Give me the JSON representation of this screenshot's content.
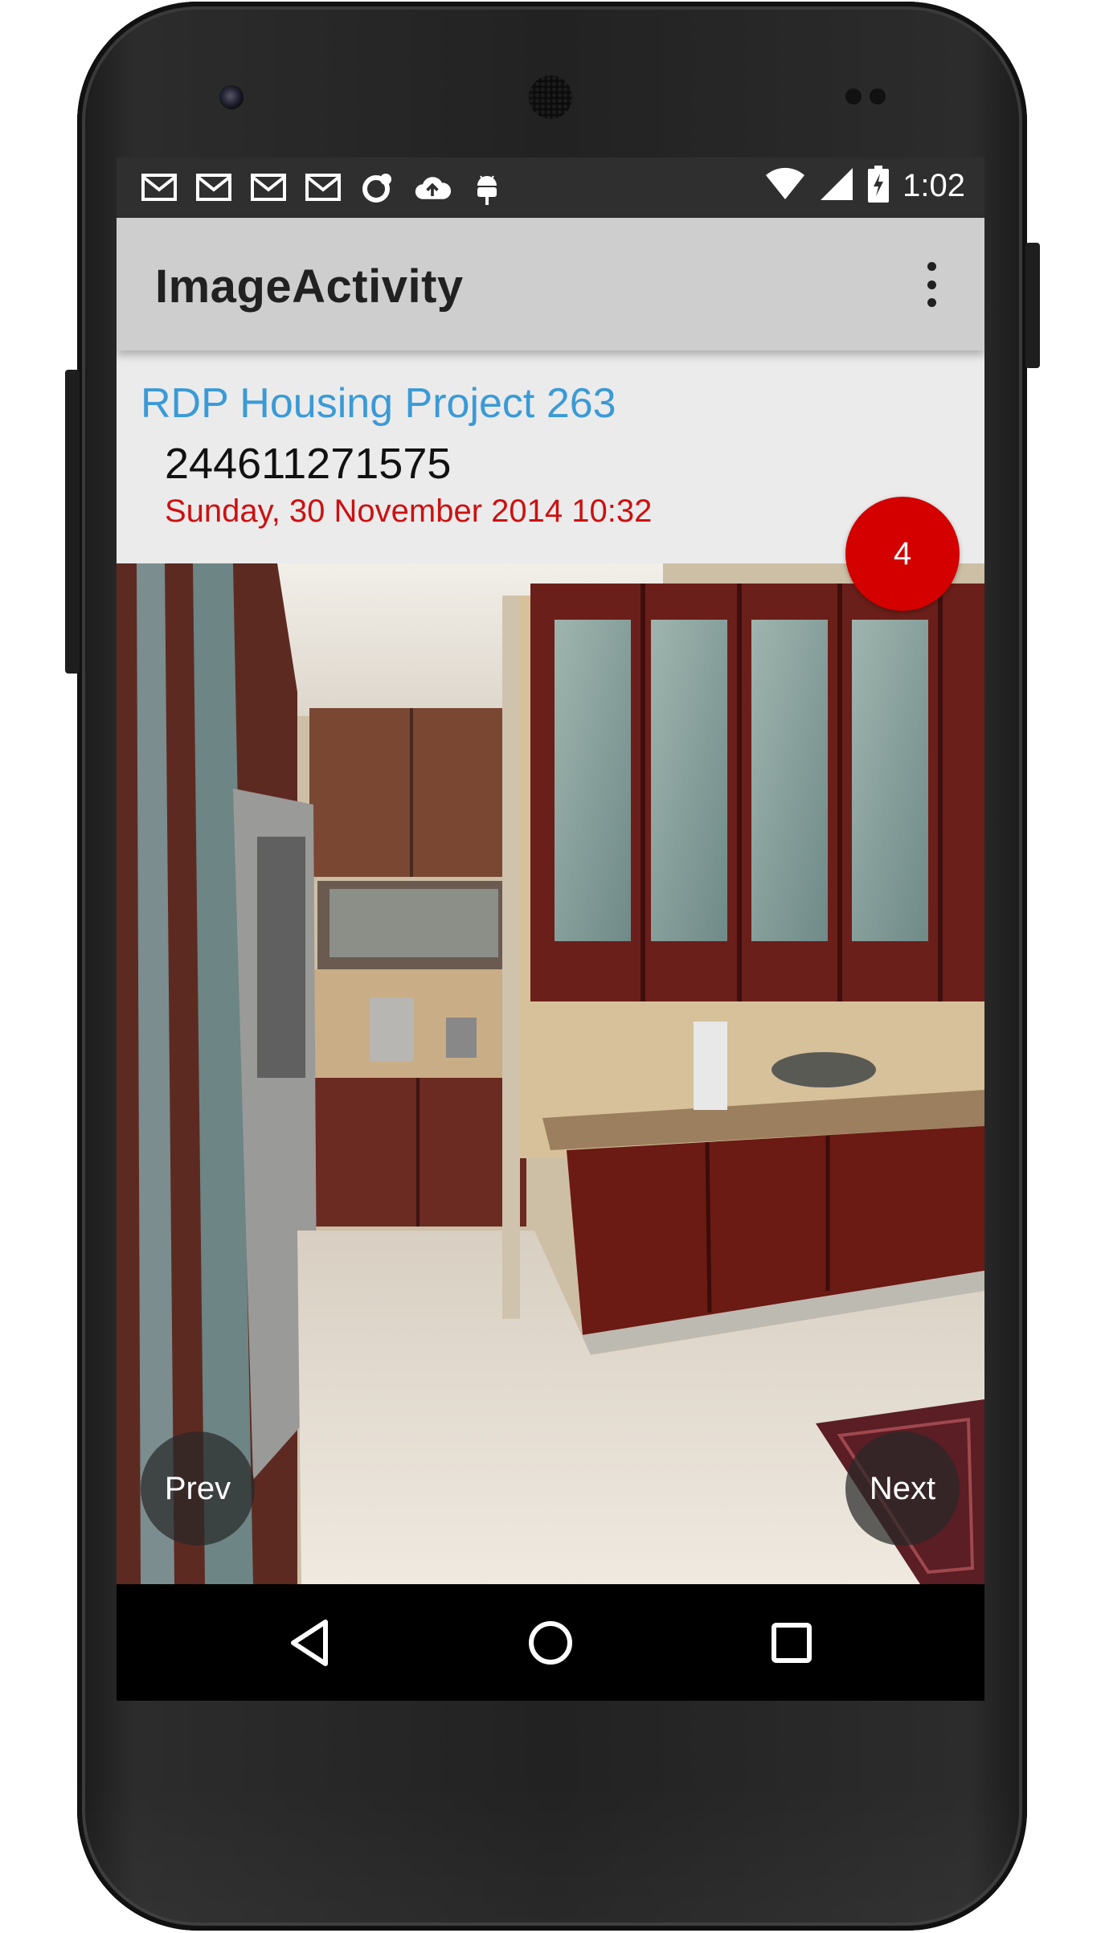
{
  "status_bar": {
    "notification_icons": [
      "gmail-icon",
      "gmail-icon",
      "gmail-icon",
      "gmail-icon",
      "sync-icon",
      "cloud-upload-icon",
      "android-debug-icon"
    ],
    "system_icons": [
      "wifi-icon",
      "cell-signal-icon",
      "battery-charging-icon"
    ],
    "time": "1:02"
  },
  "app_bar": {
    "title": "ImageActivity",
    "overflow_icon": "more-vert-icon"
  },
  "info": {
    "project_name": "RDP Housing Project 263",
    "number": "244611271575",
    "date": "Sunday, 30 November 2014 10:32"
  },
  "badge": {
    "count": "4"
  },
  "photo": {
    "content": "kitchen-photo"
  },
  "controls": {
    "prev_label": "Prev",
    "next_label": "Next"
  },
  "colors": {
    "title_blue": "#3a9ad6",
    "date_red": "#cc1111",
    "badge_red": "#d40000",
    "app_bar_bg": "#cecece",
    "info_bg": "#ebebeb"
  },
  "nav_bar": {
    "icons": [
      "back-icon",
      "home-icon",
      "recents-icon"
    ]
  }
}
